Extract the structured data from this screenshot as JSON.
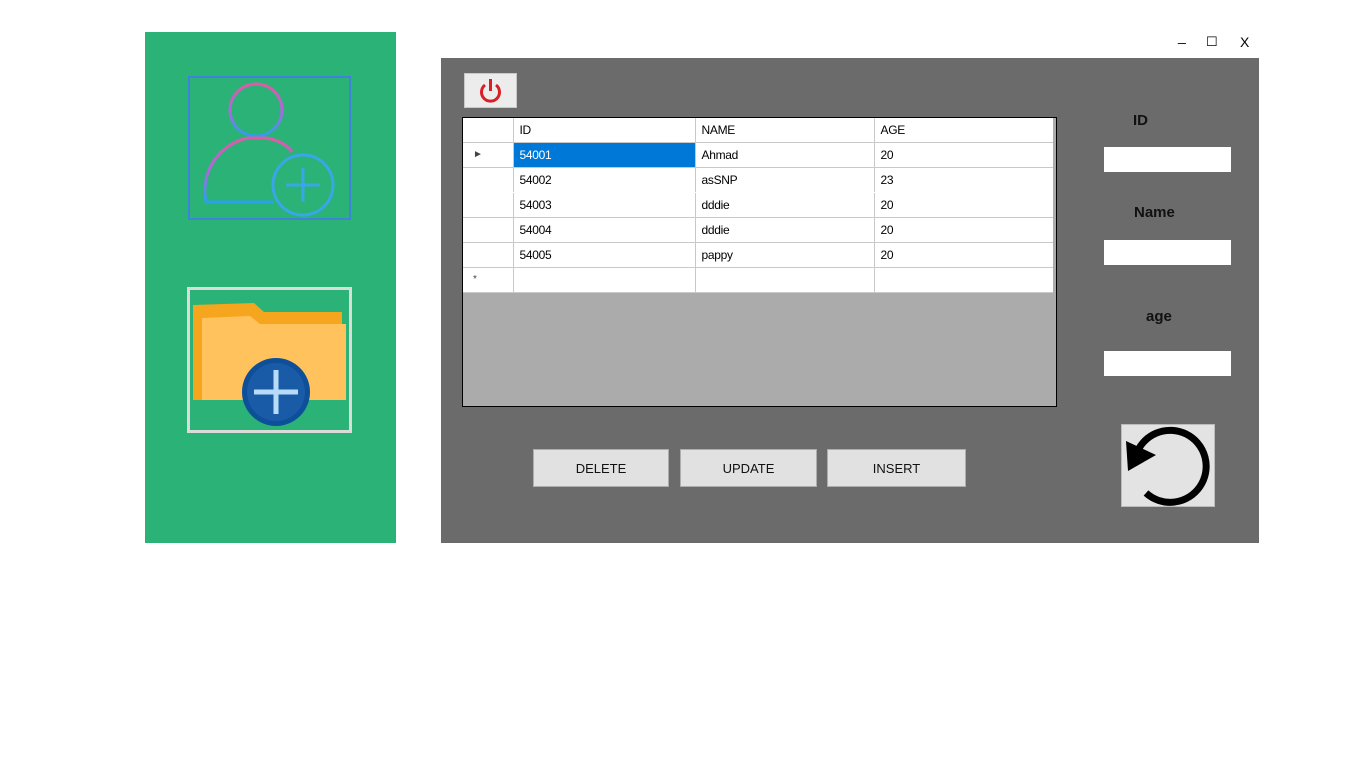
{
  "window": {
    "minimize_label": "_",
    "maximize_label": "☐",
    "close_label": "X"
  },
  "sidebar": {
    "items": [
      {
        "icon": "add-user-icon"
      },
      {
        "icon": "add-folder-icon"
      }
    ]
  },
  "grid": {
    "columns": [
      "ID",
      "NAME",
      "AGE"
    ],
    "rows": [
      {
        "marker": "►",
        "id": "54001",
        "name": "Ahmad",
        "age": "20"
      },
      {
        "marker": "",
        "id": "54002",
        "name": "asSNP",
        "age": "23"
      },
      {
        "marker": "",
        "id": "54003",
        "name": "dddie",
        "age": "20"
      },
      {
        "marker": "",
        "id": "54004",
        "name": "dddie",
        "age": "20"
      },
      {
        "marker": "",
        "id": "54005",
        "name": "pappy",
        "age": "20"
      }
    ],
    "new_row_marker": "*"
  },
  "form": {
    "id_label": "ID",
    "name_label": "Name",
    "age_label": "age",
    "id_value": "",
    "name_value": "",
    "age_value": ""
  },
  "actions": {
    "delete_label": "DELETE",
    "update_label": "UPDATE",
    "insert_label": "INSERT"
  },
  "icons": {
    "power": "power-icon",
    "refresh": "refresh-icon"
  },
  "colors": {
    "sidebar": "#2bb276",
    "panel": "#6b6b6b",
    "selection": "#0078d7",
    "power": "#d81f26"
  }
}
